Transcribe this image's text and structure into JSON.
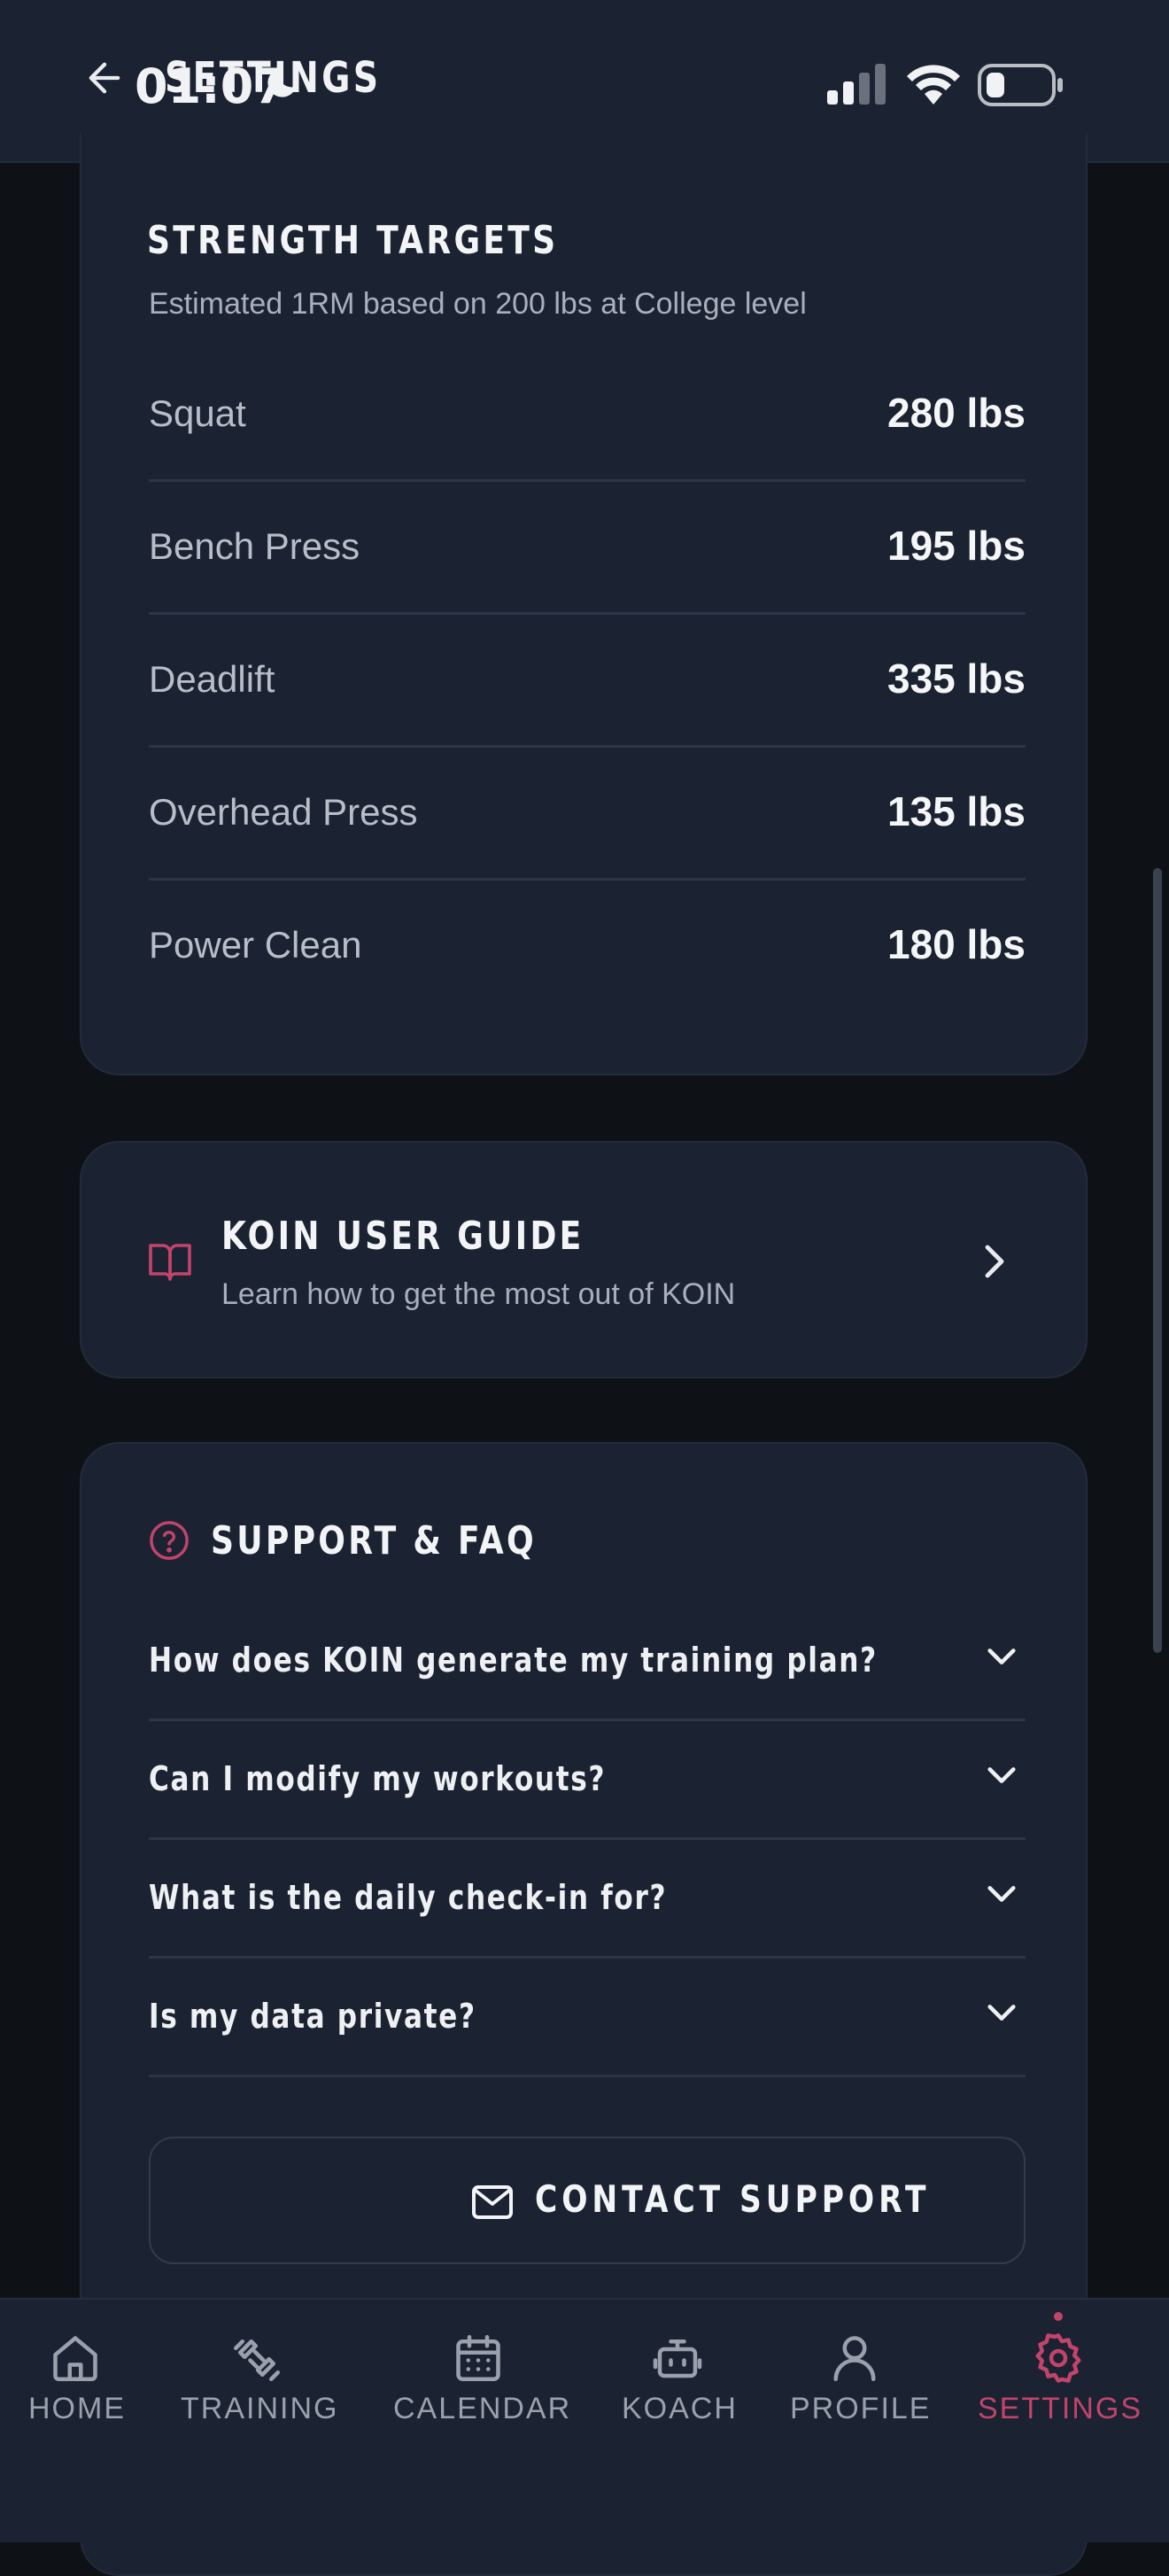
{
  "status_bar": {
    "time": "01:07",
    "icons": [
      "moon-icon",
      "signal-icon",
      "wifi-icon",
      "battery-icon"
    ]
  },
  "header": {
    "title": "SETTINGS",
    "back_icon": "arrow-left-icon"
  },
  "strength_targets": {
    "title": "STRENGTH TARGETS",
    "subtitle": "Estimated 1RM based on 200 lbs at College level",
    "rows": [
      {
        "name": "Squat",
        "value": "280 lbs"
      },
      {
        "name": "Bench Press",
        "value": "195 lbs"
      },
      {
        "name": "Deadlift",
        "value": "335 lbs"
      },
      {
        "name": "Overhead Press",
        "value": "135 lbs"
      },
      {
        "name": "Power Clean",
        "value": "180 lbs"
      }
    ]
  },
  "user_guide": {
    "title": "KOIN USER GUIDE",
    "subtitle": "Learn how to get the most out of KOIN",
    "icon": "book-icon"
  },
  "support": {
    "title": "SUPPORT & FAQ",
    "icon": "help-circle-icon",
    "faqs": [
      "How does KOIN generate my training plan?",
      "Can I modify my workouts?",
      "What is the daily check-in for?",
      "Is my data private?"
    ],
    "contact_label": "CONTACT SUPPORT"
  },
  "bottom_nav": {
    "items": [
      {
        "label": "HOME",
        "icon": "home-icon"
      },
      {
        "label": "TRAINING",
        "icon": "dumbbell-icon"
      },
      {
        "label": "CALENDAR",
        "icon": "calendar-icon"
      },
      {
        "label": "KOACH",
        "icon": "bot-icon"
      },
      {
        "label": "PROFILE",
        "icon": "user-icon"
      },
      {
        "label": "SETTINGS",
        "icon": "gear-icon"
      }
    ],
    "active": "SETTINGS"
  },
  "colors": {
    "accent": "#c2446b",
    "card": "#1b2231",
    "background": "#0e1217"
  }
}
